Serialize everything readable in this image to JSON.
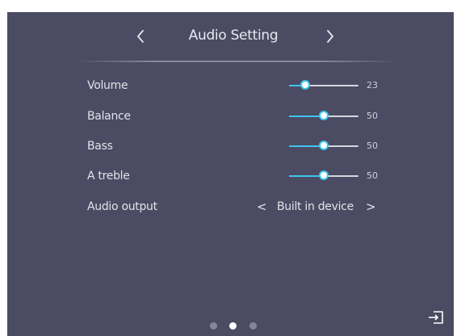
{
  "header": {
    "title": "Audio Setting",
    "prev_icon": "chevron-left-icon",
    "next_icon": "chevron-right-icon"
  },
  "settings": [
    {
      "label": "Volume",
      "value": "23",
      "level": 0.23
    },
    {
      "label": "Balance",
      "value": "50",
      "level": 0.5
    },
    {
      "label": "Bass",
      "value": "50",
      "level": 0.5
    },
    {
      "label": "A treble",
      "value": "50",
      "level": 0.5
    }
  ],
  "audio_output": {
    "label": "Audio output",
    "value": "Built in device",
    "prev_glyph": "<",
    "next_glyph": ">"
  },
  "pager": {
    "pages": 3,
    "active_index": 1
  },
  "footer": {
    "input_icon": "input-source-icon"
  },
  "colors": {
    "background": "#4b4b63",
    "accent": "#3ec4ef",
    "text": "#e2e2ea"
  }
}
